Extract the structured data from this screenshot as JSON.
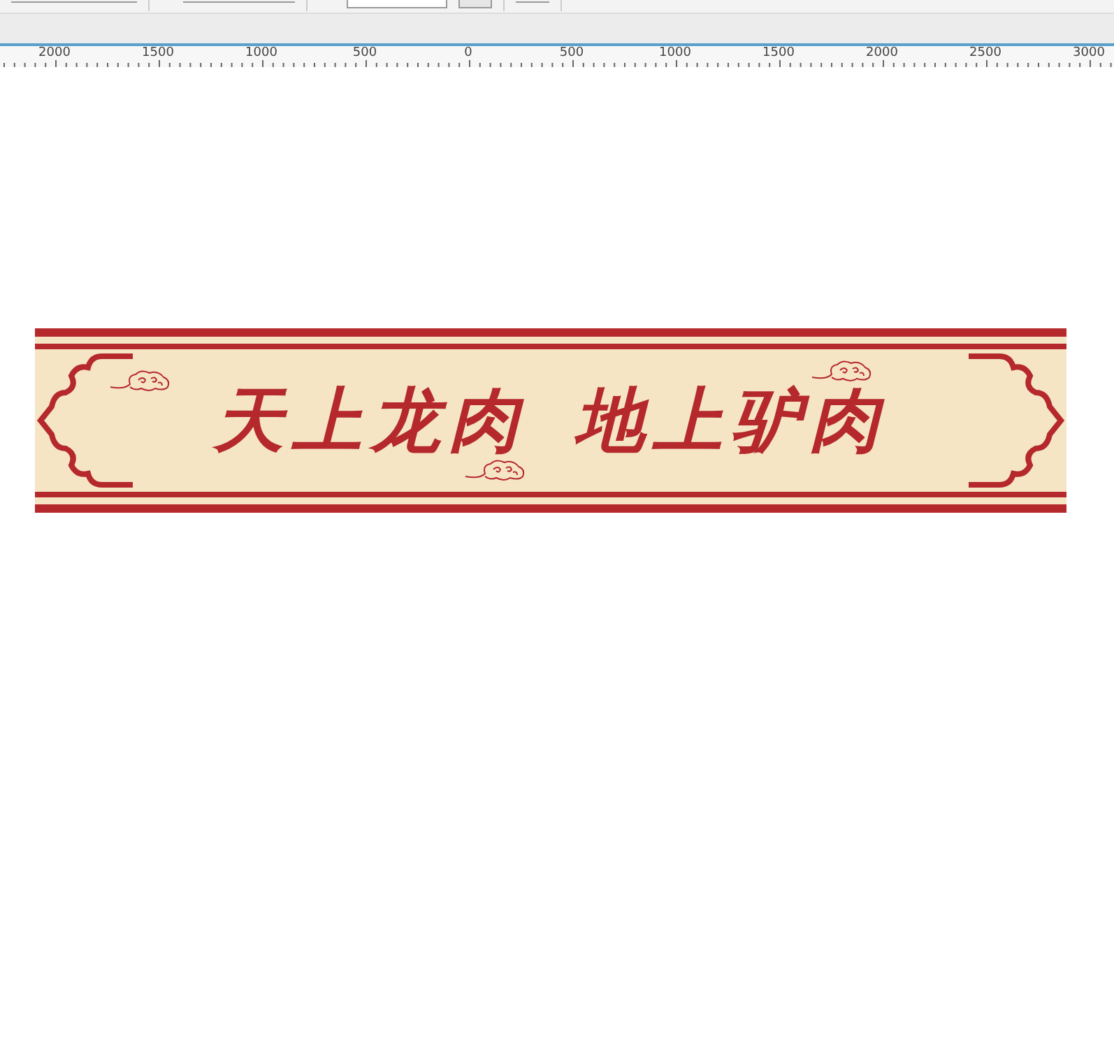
{
  "ruler": {
    "labels": [
      "2000",
      "1500",
      "1000",
      "500",
      "0",
      "500",
      "1000",
      "1500",
      "2000",
      "2500",
      "3000"
    ]
  },
  "banner": {
    "phrases": [
      "天上龙肉",
      "地上驴肉"
    ]
  }
}
